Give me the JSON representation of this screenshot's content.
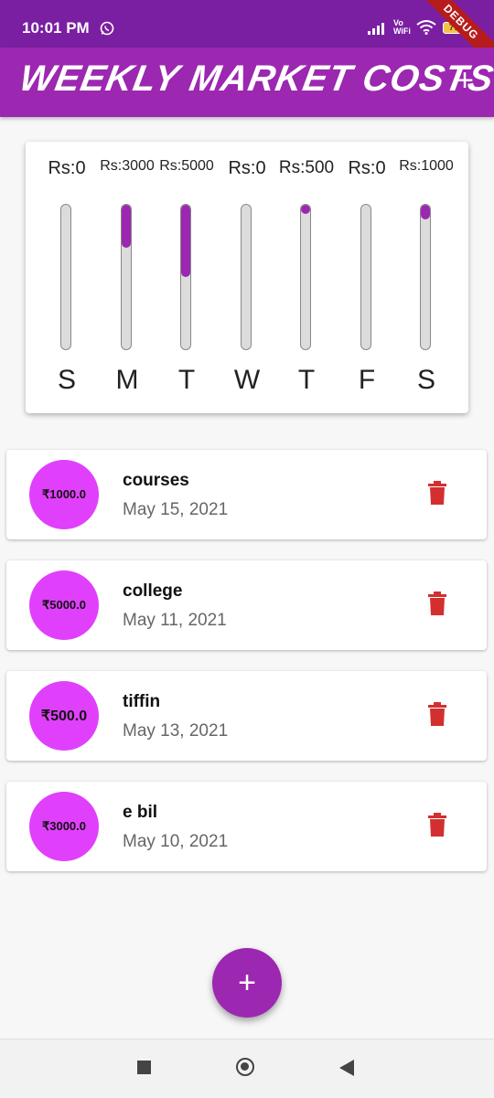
{
  "status_bar": {
    "time": "10:01 PM",
    "vowifi": "Vo WiFi",
    "battery": "77",
    "debug_banner": "DEBUG"
  },
  "app_bar": {
    "title": "WEEKLY MARKET COSTS",
    "add_icon": "plus-icon"
  },
  "chart": {
    "days": [
      {
        "label": "S",
        "amount": "Rs:0",
        "fill_fraction": 0
      },
      {
        "label": "M",
        "amount": "Rs:3000",
        "fill_fraction": 0.3
      },
      {
        "label": "T",
        "amount": "Rs:5000",
        "fill_fraction": 0.5
      },
      {
        "label": "W",
        "amount": "Rs:0",
        "fill_fraction": 0
      },
      {
        "label": "T",
        "amount": "Rs:500",
        "fill_fraction": 0.05
      },
      {
        "label": "F",
        "amount": "Rs:0",
        "fill_fraction": 0
      },
      {
        "label": "S",
        "amount": "Rs:1000",
        "fill_fraction": 0.1
      }
    ],
    "accent_color": "#9c27b0",
    "track_color": "#dcdcdc"
  },
  "transactions": [
    {
      "amount": "₹1000.0",
      "title": "courses",
      "date": "May 15, 2021"
    },
    {
      "amount": "₹5000.0",
      "title": "college",
      "date": "May 11, 2021"
    },
    {
      "amount": "₹500.0",
      "title": "tiffin",
      "date": "May 13, 2021"
    },
    {
      "amount": "₹3000.0",
      "title": "e bil",
      "date": "May 10, 2021"
    }
  ],
  "colors": {
    "primary": "#9c27b0",
    "avatar": "#e040fb",
    "delete": "#d32f2f"
  },
  "fab": {
    "icon": "plus-icon"
  }
}
